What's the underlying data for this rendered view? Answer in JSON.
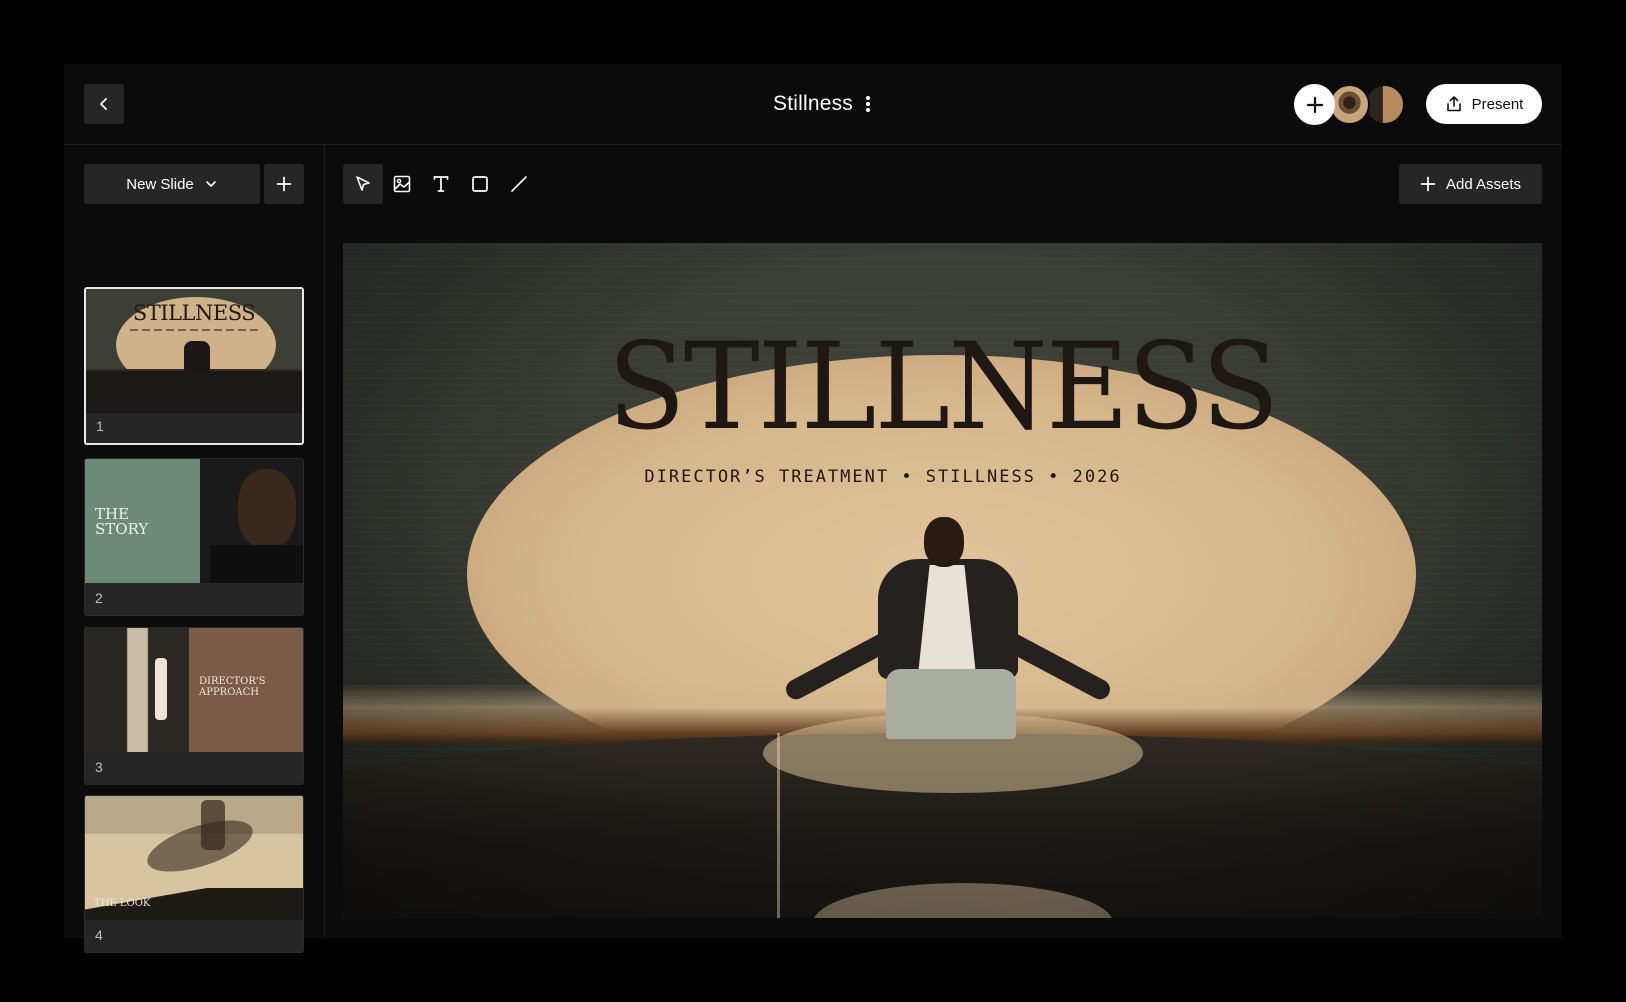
{
  "header": {
    "title": "Stillness",
    "present_label": "Present"
  },
  "sidebar": {
    "new_slide_label": "New Slide",
    "slides": [
      {
        "number": "1",
        "title": "STILLNESS",
        "active": true
      },
      {
        "number": "2",
        "title": "THE STORY"
      },
      {
        "number": "3",
        "title": "DIRECTOR'S APPROACH"
      },
      {
        "number": "4",
        "title": "THE LOOK"
      }
    ]
  },
  "toolbar": {
    "tools": [
      "pointer-icon",
      "image-icon",
      "text-icon",
      "rectangle-icon",
      "line-icon"
    ],
    "add_assets_label": "Add Assets"
  },
  "slide": {
    "title": "STILLNESS",
    "subtitle": "DIRECTOR’S TREATMENT  •  STILLNESS  •  2026"
  },
  "colors": {
    "background": "#000000",
    "app_bg": "#0b0b0b",
    "button_bg": "#262626",
    "accent_sage": "#6b8a78",
    "accent_brown": "#7b5a48"
  }
}
